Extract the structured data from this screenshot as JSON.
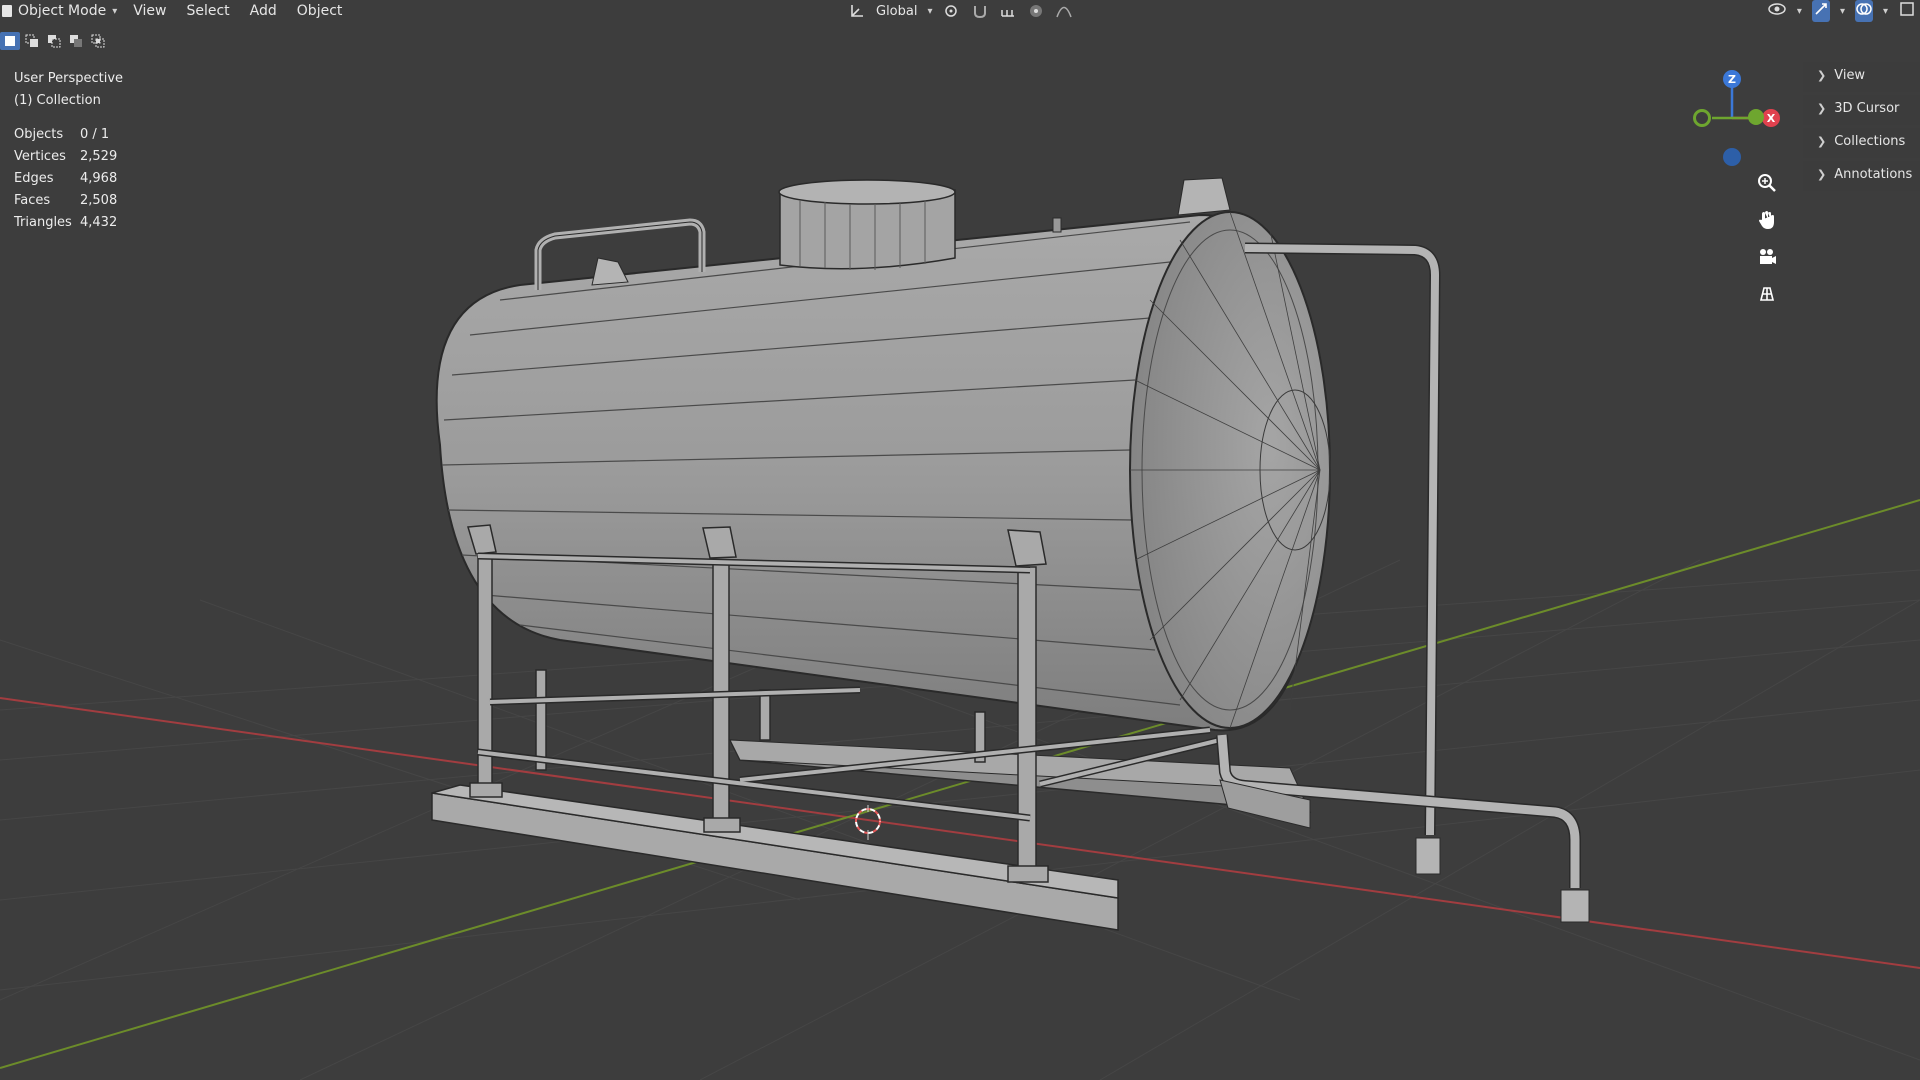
{
  "header": {
    "mode_label": "Object Mode",
    "menus": [
      "View",
      "Select",
      "Add",
      "Object"
    ],
    "transform_orientation": "Global"
  },
  "overlay": {
    "view_name": "User Perspective",
    "collection": "(1) Collection",
    "stats": [
      {
        "label": "Objects",
        "value": "0 / 1"
      },
      {
        "label": "Vertices",
        "value": "2,529"
      },
      {
        "label": "Edges",
        "value": "4,968"
      },
      {
        "label": "Faces",
        "value": "2,508"
      },
      {
        "label": "Triangles",
        "value": "4,432"
      }
    ]
  },
  "gizmo": {
    "z_label": "Z",
    "x_label": "X",
    "colors": {
      "x": "#e0414e",
      "y": "#6ea62f",
      "z": "#3b78d8"
    }
  },
  "sidebar": {
    "items": [
      "View",
      "3D Cursor",
      "Collections",
      "Annotations"
    ]
  },
  "colors": {
    "background": "#3d3d3d",
    "grid": "#474747",
    "x_axis": "#a23d40",
    "y_axis": "#6c8c2a",
    "mesh": "#9a9a9a",
    "wire": "#2a2a2a",
    "accent": "#4772b3"
  }
}
